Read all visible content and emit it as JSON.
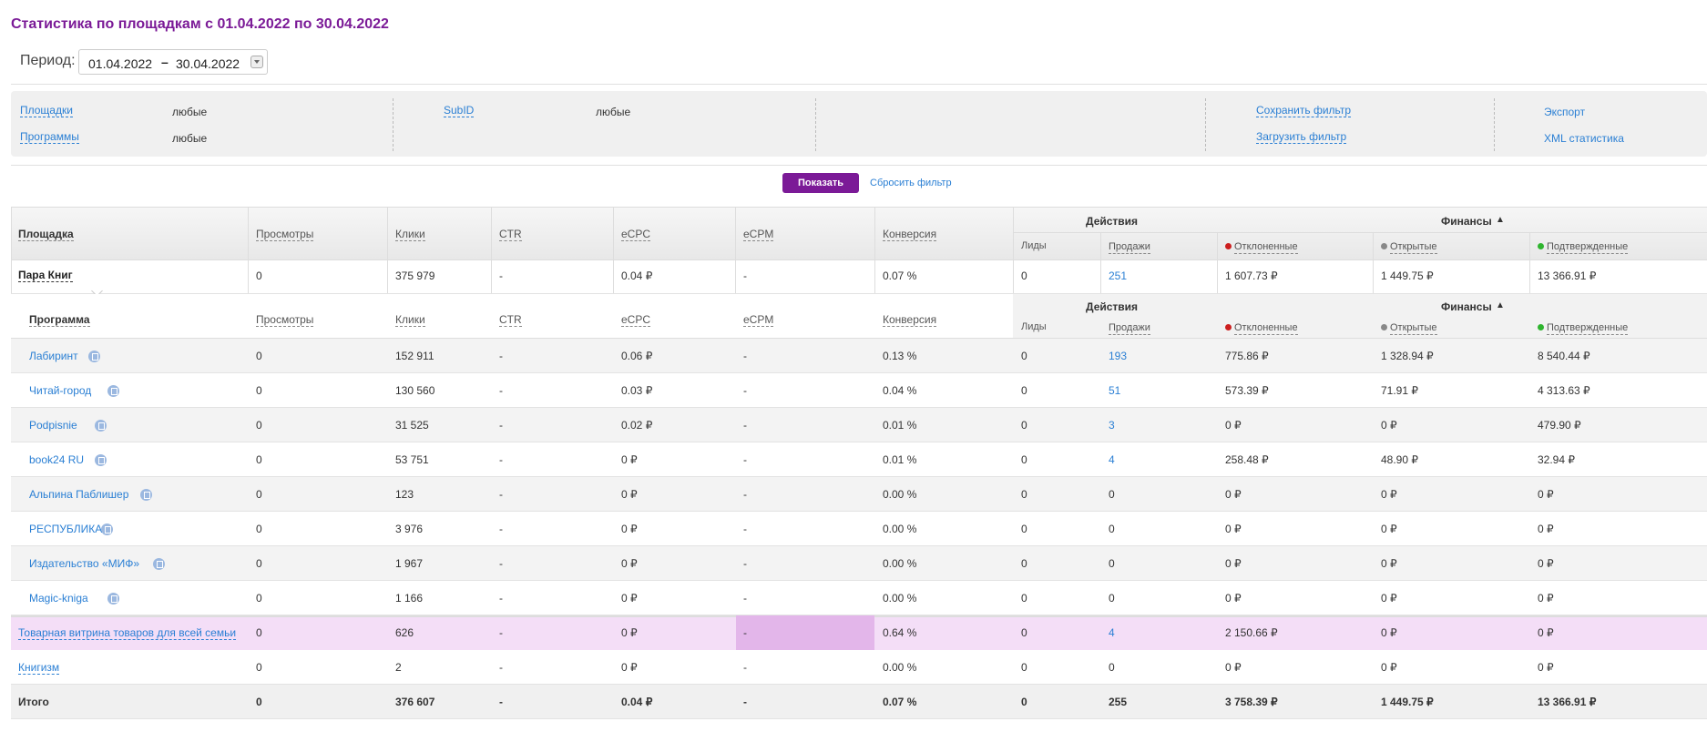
{
  "title": "Статистика по площадкам с 01.04.2022 по 30.04.2022",
  "period": {
    "label": "Период:",
    "from": "01.04.2022",
    "dash": "–",
    "to": "30.04.2022"
  },
  "filters": {
    "platforms_label": "Площадки",
    "platforms_value": "любые",
    "programs_label": "Программы",
    "programs_value": "любые",
    "subid_label": "SubID",
    "subid_value": "любые",
    "save_filter": "Сохранить фильтр",
    "load_filter": "Загрузить фильтр",
    "export": "Экспорт",
    "xml": "XML статистика"
  },
  "buttons": {
    "show": "Показать",
    "reset": "Сбросить фильтр"
  },
  "headers": {
    "platform": "Площадка",
    "program": "Программа",
    "views": "Просмотры",
    "clicks": "Клики",
    "ctr": "CTR",
    "ecpc": "eCPC",
    "ecpm": "eCPM",
    "conversion": "Конверсия",
    "actions": "Действия",
    "finance": "Финансы",
    "leads": "Лиды",
    "sales": "Продажи",
    "rejected": "Отклоненные",
    "open": "Открытые",
    "confirmed": "Подтвержденные"
  },
  "colors": {
    "accent": "#7b1a97",
    "link": "#2a7fd4",
    "highlight": "#f4def7",
    "highlight_strong": "#e3b6ea",
    "dot_rejected": "#cc1f1f",
    "dot_open": "#888888",
    "dot_confirmed": "#2fb52f"
  },
  "group": {
    "name": "Пара Книг",
    "views": "0",
    "clicks": "375 979",
    "ctr": "-",
    "ecpc": "0.04 ₽",
    "ecpm": "-",
    "conv": "0.07 %",
    "leads": "0",
    "sales": "251",
    "rejected": "1 607.73 ₽",
    "open": "1 449.75 ₽",
    "confirmed": "13 366.91 ₽"
  },
  "programs": [
    {
      "name": "Лабиринт",
      "views": "0",
      "clicks": "152 911",
      "ctr": "-",
      "ecpc": "0.06 ₽",
      "ecpm": "-",
      "conv": "0.13 %",
      "leads": "0",
      "sales": "193",
      "rejected": "775.86 ₽",
      "open": "1 328.94 ₽",
      "confirmed": "8 540.44 ₽"
    },
    {
      "name": "Читай-город",
      "views": "0",
      "clicks": "130 560",
      "ctr": "-",
      "ecpc": "0.03 ₽",
      "ecpm": "-",
      "conv": "0.04 %",
      "leads": "0",
      "sales": "51",
      "rejected": "573.39 ₽",
      "open": "71.91 ₽",
      "confirmed": "4 313.63 ₽"
    },
    {
      "name": "Podpisnie",
      "views": "0",
      "clicks": "31 525",
      "ctr": "-",
      "ecpc": "0.02 ₽",
      "ecpm": "-",
      "conv": "0.01 %",
      "leads": "0",
      "sales": "3",
      "rejected": "0 ₽",
      "open": "0 ₽",
      "confirmed": "479.90 ₽"
    },
    {
      "name": "book24 RU",
      "views": "0",
      "clicks": "53 751",
      "ctr": "-",
      "ecpc": "0 ₽",
      "ecpm": "-",
      "conv": "0.01 %",
      "leads": "0",
      "sales": "4",
      "rejected": "258.48 ₽",
      "open": "48.90 ₽",
      "confirmed": "32.94 ₽"
    },
    {
      "name": "Альпина Паблишер",
      "views": "0",
      "clicks": "123",
      "ctr": "-",
      "ecpc": "0 ₽",
      "ecpm": "-",
      "conv": "0.00 %",
      "leads": "0",
      "sales": "0",
      "rejected": "0 ₽",
      "open": "0 ₽",
      "confirmed": "0 ₽"
    },
    {
      "name": "РЕСПУБЛИКА",
      "views": "0",
      "clicks": "3 976",
      "ctr": "-",
      "ecpc": "0 ₽",
      "ecpm": "-",
      "conv": "0.00 %",
      "leads": "0",
      "sales": "0",
      "rejected": "0 ₽",
      "open": "0 ₽",
      "confirmed": "0 ₽"
    },
    {
      "name": "Издательство «МИФ»",
      "views": "0",
      "clicks": "1 967",
      "ctr": "-",
      "ecpc": "0 ₽",
      "ecpm": "-",
      "conv": "0.00 %",
      "leads": "0",
      "sales": "0",
      "rejected": "0 ₽",
      "open": "0 ₽",
      "confirmed": "0 ₽"
    },
    {
      "name": "Magic-kniga",
      "views": "0",
      "clicks": "1 166",
      "ctr": "-",
      "ecpc": "0 ₽",
      "ecpm": "-",
      "conv": "0.00 %",
      "leads": "0",
      "sales": "0",
      "rejected": "0 ₽",
      "open": "0 ₽",
      "confirmed": "0 ₽"
    }
  ],
  "platforms": [
    {
      "name": "Товарная витрина товаров для всей семьи",
      "views": "0",
      "clicks": "626",
      "ctr": "-",
      "ecpc": "0 ₽",
      "ecpm": "-",
      "conv": "0.64 %",
      "leads": "0",
      "sales": "4",
      "rejected": "2 150.66 ₽",
      "open": "0 ₽",
      "confirmed": "0 ₽"
    },
    {
      "name": "Книгизм",
      "views": "0",
      "clicks": "2",
      "ctr": "-",
      "ecpc": "0 ₽",
      "ecpm": "-",
      "conv": "0.00 %",
      "leads": "0",
      "sales": "0",
      "rejected": "0 ₽",
      "open": "0 ₽",
      "confirmed": "0 ₽"
    }
  ],
  "total": {
    "name": "Итого",
    "views": "0",
    "clicks": "376 607",
    "ctr": "-",
    "ecpc": "0.04 ₽",
    "ecpm": "-",
    "conv": "0.07 %",
    "leads": "0",
    "sales": "255",
    "rejected": "3 758.39 ₽",
    "open": "1 449.75 ₽",
    "confirmed": "13 366.91 ₽"
  }
}
